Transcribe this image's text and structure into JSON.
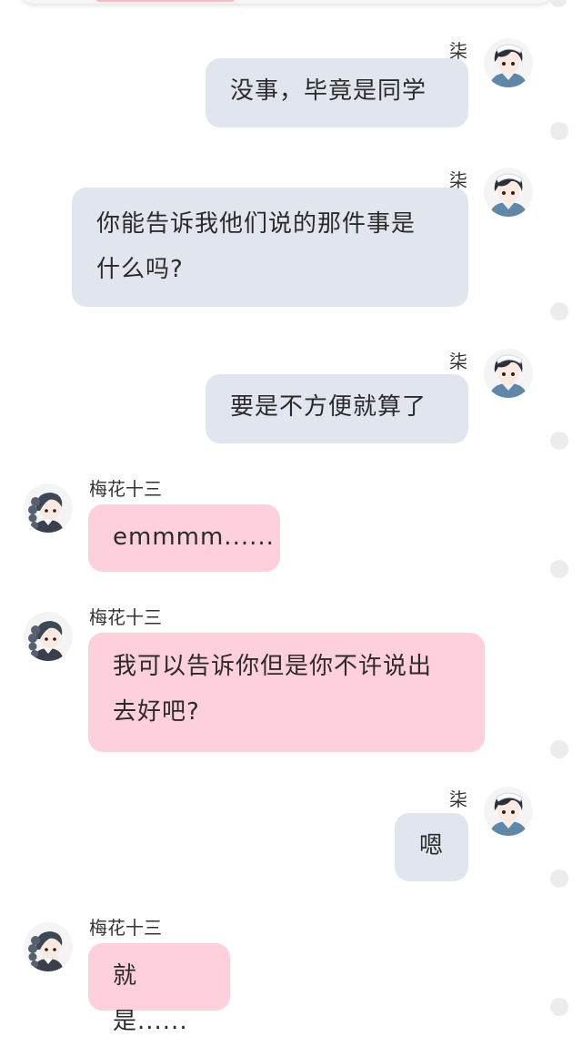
{
  "colors": {
    "self_bubble": "#e1e6ee",
    "other_bubble": "#fdd0db",
    "status_dot": "#ececec"
  },
  "messages": [
    {
      "side": "right",
      "sender": "柒",
      "avatar": "boy-avatar",
      "lines": [
        "没事，毕竟是同学"
      ]
    },
    {
      "side": "right",
      "sender": "柒",
      "avatar": "boy-avatar",
      "lines": [
        "你能告诉我他们说的那件事是",
        "什么吗?"
      ]
    },
    {
      "side": "right",
      "sender": "柒",
      "avatar": "boy-avatar",
      "lines": [
        "要是不方便就算了"
      ]
    },
    {
      "side": "left",
      "sender": "梅花十三",
      "avatar": "girl-avatar",
      "lines": [
        "emmmm......"
      ]
    },
    {
      "side": "left",
      "sender": "梅花十三",
      "avatar": "girl-avatar",
      "lines": [
        "我可以告诉你但是你不许说出",
        "去好吧?"
      ]
    },
    {
      "side": "right",
      "sender": "柒",
      "avatar": "boy-avatar",
      "lines": [
        "嗯"
      ]
    },
    {
      "side": "left",
      "sender": "梅花十三",
      "avatar": "girl-avatar",
      "lines": [
        "就是......"
      ]
    }
  ]
}
